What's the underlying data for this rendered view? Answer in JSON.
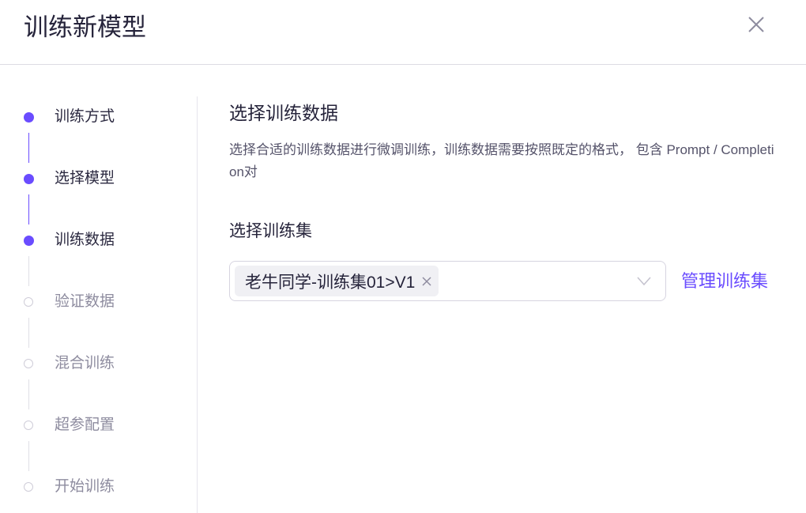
{
  "dialog": {
    "title": "训练新模型",
    "close_icon": "close-icon"
  },
  "steps": [
    {
      "label": "训练方式",
      "status": "done"
    },
    {
      "label": "选择模型",
      "status": "done"
    },
    {
      "label": "训练数据",
      "status": "done"
    },
    {
      "label": "验证数据",
      "status": "todo"
    },
    {
      "label": "混合训练",
      "status": "todo"
    },
    {
      "label": "超参配置",
      "status": "todo"
    },
    {
      "label": "开始训练",
      "status": "todo"
    }
  ],
  "section": {
    "title": "选择训练数据",
    "description": "选择合适的训练数据进行微调训练，训练数据需要按照既定的格式， 包含 Prompt / Completion对",
    "field_label": "选择训练集",
    "selected_tag": "老牛同学-训练集01>V1",
    "manage_link": "管理训练集"
  },
  "colors": {
    "accent": "#6a4cff"
  }
}
